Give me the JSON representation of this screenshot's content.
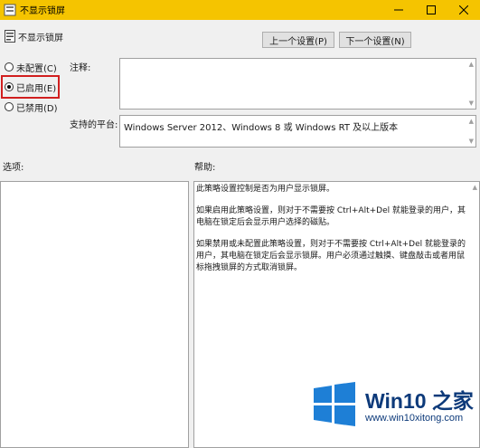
{
  "window": {
    "title": "不显示锁屏"
  },
  "header": {
    "policy_name": "不显示锁屏",
    "prev_button": "上一个设置(P)",
    "next_button": "下一个设置(N)"
  },
  "options": {
    "not_configured": "未配置(C)",
    "enabled": "已启用(E)",
    "disabled": "已禁用(D)",
    "selected": "enabled"
  },
  "fields": {
    "comment_label": "注释:",
    "comment_value": "",
    "supported_label": "支持的平台:",
    "supported_value": "Windows Server 2012、Windows 8 或 Windows RT 及以上版本"
  },
  "panes": {
    "options_label": "选项:",
    "help_label": "帮助:",
    "help_paragraphs": [
      "此策略设置控制是否为用户显示锁屏。",
      "如果启用此策略设置，则对于不需要按 Ctrl+Alt+Del 就能登录的用户，其电脑在锁定后会显示用户选择的磁贴。",
      "如果禁用或未配置此策略设置，则对于不需要按 Ctrl+Alt+Del 就能登录的用户，其电脑在锁定后会显示锁屏。用户必须通过触摸、键盘敲击或者用鼠标拖拽锁屏的方式取消锁屏。"
    ]
  },
  "watermark": {
    "brand": "Win10 之家",
    "url": "www.win10xitong.com"
  },
  "colors": {
    "titlebar": "#f5c400",
    "highlight": "#d11f1f",
    "logo_blue": "#1e7fd6"
  }
}
